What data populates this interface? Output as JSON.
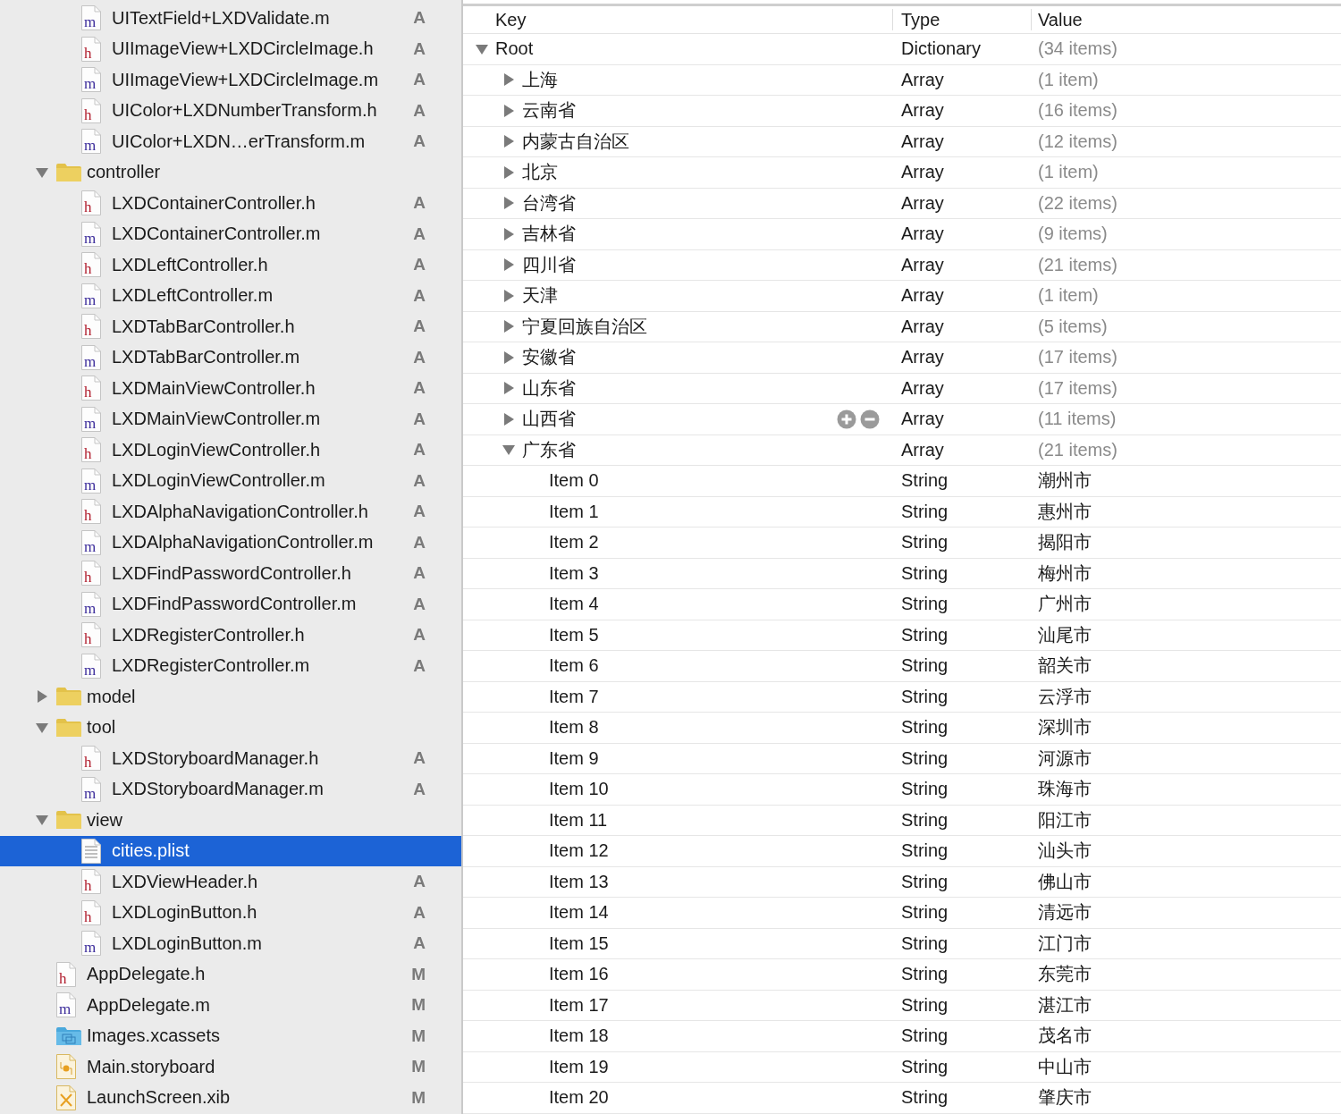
{
  "navigator": {
    "leading_items": [
      {
        "label": "UITextField+LXDValidate.m",
        "kind": "source",
        "icon_letter": "m",
        "status": "A",
        "selected": false
      },
      {
        "label": "UIImageView+LXDCircleImage.h",
        "kind": "header",
        "icon_letter": "h",
        "status": "A",
        "selected": false
      },
      {
        "label": "UIImageView+LXDCircleImage.m",
        "kind": "source",
        "icon_letter": "m",
        "status": "A",
        "selected": false
      },
      {
        "label": "UIColor+LXDNumberTransform.h",
        "kind": "header",
        "icon_letter": "h",
        "status": "A",
        "selected": false
      },
      {
        "label": "UIColor+LXDN…erTransform.m",
        "kind": "source",
        "icon_letter": "m",
        "status": "A",
        "selected": false
      }
    ],
    "items": [
      {
        "label": "controller",
        "kind": "folder",
        "expanded": true,
        "selected": false,
        "children": [
          {
            "label": "LXDContainerController.h",
            "kind": "header",
            "icon_letter": "h",
            "status": "A",
            "selected": false
          },
          {
            "label": "LXDContainerController.m",
            "kind": "source",
            "icon_letter": "m",
            "status": "A",
            "selected": false
          },
          {
            "label": "LXDLeftController.h",
            "kind": "header",
            "icon_letter": "h",
            "status": "A",
            "selected": false
          },
          {
            "label": "LXDLeftController.m",
            "kind": "source",
            "icon_letter": "m",
            "status": "A",
            "selected": false
          },
          {
            "label": "LXDTabBarController.h",
            "kind": "header",
            "icon_letter": "h",
            "status": "A",
            "selected": false
          },
          {
            "label": "LXDTabBarController.m",
            "kind": "source",
            "icon_letter": "m",
            "status": "A",
            "selected": false
          },
          {
            "label": "LXDMainViewController.h",
            "kind": "header",
            "icon_letter": "h",
            "status": "A",
            "selected": false
          },
          {
            "label": "LXDMainViewController.m",
            "kind": "source",
            "icon_letter": "m",
            "status": "A",
            "selected": false
          },
          {
            "label": "LXDLoginViewController.h",
            "kind": "header",
            "icon_letter": "h",
            "status": "A",
            "selected": false
          },
          {
            "label": "LXDLoginViewController.m",
            "kind": "source",
            "icon_letter": "m",
            "status": "A",
            "selected": false
          },
          {
            "label": "LXDAlphaNavigationController.h",
            "kind": "header",
            "icon_letter": "h",
            "status": "A",
            "selected": false
          },
          {
            "label": "LXDAlphaNavigationController.m",
            "kind": "source",
            "icon_letter": "m",
            "status": "A",
            "selected": false
          },
          {
            "label": "LXDFindPasswordController.h",
            "kind": "header",
            "icon_letter": "h",
            "status": "A",
            "selected": false
          },
          {
            "label": "LXDFindPasswordController.m",
            "kind": "source",
            "icon_letter": "m",
            "status": "A",
            "selected": false
          },
          {
            "label": "LXDRegisterController.h",
            "kind": "header",
            "icon_letter": "h",
            "status": "A",
            "selected": false
          },
          {
            "label": "LXDRegisterController.m",
            "kind": "source",
            "icon_letter": "m",
            "status": "A",
            "selected": false
          }
        ]
      },
      {
        "label": "model",
        "kind": "folder",
        "expanded": false,
        "selected": false
      },
      {
        "label": "tool",
        "kind": "folder",
        "expanded": true,
        "selected": false,
        "children": [
          {
            "label": "LXDStoryboardManager.h",
            "kind": "header",
            "icon_letter": "h",
            "status": "A",
            "selected": false
          },
          {
            "label": "LXDStoryboardManager.m",
            "kind": "source",
            "icon_letter": "m",
            "status": "A",
            "selected": false
          }
        ]
      },
      {
        "label": "view",
        "kind": "folder",
        "expanded": true,
        "selected": false,
        "children": [
          {
            "label": "cities.plist",
            "kind": "plist",
            "selected": true
          },
          {
            "label": "LXDViewHeader.h",
            "kind": "header",
            "icon_letter": "h",
            "status": "A",
            "selected": false
          },
          {
            "label": "LXDLoginButton.h",
            "kind": "header",
            "icon_letter": "h",
            "status": "A",
            "selected": false
          },
          {
            "label": "LXDLoginButton.m",
            "kind": "source",
            "icon_letter": "m",
            "status": "A",
            "selected": false
          }
        ]
      },
      {
        "label": "AppDelegate.h",
        "kind": "header",
        "icon_letter": "h",
        "status": "M",
        "selected": false
      },
      {
        "label": "AppDelegate.m",
        "kind": "source",
        "icon_letter": "m",
        "status": "M",
        "selected": false
      },
      {
        "label": "Images.xcassets",
        "kind": "assets",
        "status": "M",
        "selected": false
      },
      {
        "label": "Main.storyboard",
        "kind": "storyboard",
        "status": "M",
        "selected": false
      },
      {
        "label": "LaunchScreen.xib",
        "kind": "xib",
        "status": "M",
        "selected": false
      }
    ]
  },
  "plist": {
    "columns": [
      "Key",
      "Type",
      "Value"
    ],
    "root": {
      "key": "Root",
      "type": "Dictionary",
      "value": "(34 items)",
      "kind": "container",
      "expanded": true,
      "hovered": false,
      "children": [
        {
          "key": "上海",
          "type": "Array",
          "value": "(1 item)",
          "kind": "container",
          "expanded": false,
          "hovered": false
        },
        {
          "key": "云南省",
          "type": "Array",
          "value": "(16 items)",
          "kind": "container",
          "expanded": false,
          "hovered": false
        },
        {
          "key": "内蒙古自治区",
          "type": "Array",
          "value": "(12 items)",
          "kind": "container",
          "expanded": false,
          "hovered": false
        },
        {
          "key": "北京",
          "type": "Array",
          "value": "(1 item)",
          "kind": "container",
          "expanded": false,
          "hovered": false
        },
        {
          "key": "台湾省",
          "type": "Array",
          "value": "(22 items)",
          "kind": "container",
          "expanded": false,
          "hovered": false
        },
        {
          "key": "吉林省",
          "type": "Array",
          "value": "(9 items)",
          "kind": "container",
          "expanded": false,
          "hovered": false
        },
        {
          "key": "四川省",
          "type": "Array",
          "value": "(21 items)",
          "kind": "container",
          "expanded": false,
          "hovered": false
        },
        {
          "key": "天津",
          "type": "Array",
          "value": "(1 item)",
          "kind": "container",
          "expanded": false,
          "hovered": false
        },
        {
          "key": "宁夏回族自治区",
          "type": "Array",
          "value": "(5 items)",
          "kind": "container",
          "expanded": false,
          "hovered": false
        },
        {
          "key": "安徽省",
          "type": "Array",
          "value": "(17 items)",
          "kind": "container",
          "expanded": false,
          "hovered": false
        },
        {
          "key": "山东省",
          "type": "Array",
          "value": "(17 items)",
          "kind": "container",
          "expanded": false,
          "hovered": false
        },
        {
          "key": "山西省",
          "type": "Array",
          "value": "(11 items)",
          "kind": "container",
          "expanded": false,
          "hovered": true
        },
        {
          "key": "广东省",
          "type": "Array",
          "value": "(21 items)",
          "kind": "container",
          "expanded": true,
          "hovered": false,
          "children": [
            {
              "key": "Item 0",
              "type": "String",
              "value": "潮州市",
              "kind": "string",
              "hovered": false
            },
            {
              "key": "Item 1",
              "type": "String",
              "value": "惠州市",
              "kind": "string",
              "hovered": false
            },
            {
              "key": "Item 2",
              "type": "String",
              "value": "揭阳市",
              "kind": "string",
              "hovered": false
            },
            {
              "key": "Item 3",
              "type": "String",
              "value": "梅州市",
              "kind": "string",
              "hovered": false
            },
            {
              "key": "Item 4",
              "type": "String",
              "value": "广州市",
              "kind": "string",
              "hovered": false
            },
            {
              "key": "Item 5",
              "type": "String",
              "value": "汕尾市",
              "kind": "string",
              "hovered": false
            },
            {
              "key": "Item 6",
              "type": "String",
              "value": "韶关市",
              "kind": "string",
              "hovered": false
            },
            {
              "key": "Item 7",
              "type": "String",
              "value": "云浮市",
              "kind": "string",
              "hovered": false
            },
            {
              "key": "Item 8",
              "type": "String",
              "value": "深圳市",
              "kind": "string",
              "hovered": false
            },
            {
              "key": "Item 9",
              "type": "String",
              "value": "河源市",
              "kind": "string",
              "hovered": false
            },
            {
              "key": "Item 10",
              "type": "String",
              "value": "珠海市",
              "kind": "string",
              "hovered": false
            },
            {
              "key": "Item 11",
              "type": "String",
              "value": "阳江市",
              "kind": "string",
              "hovered": false
            },
            {
              "key": "Item 12",
              "type": "String",
              "value": "汕头市",
              "kind": "string",
              "hovered": false
            },
            {
              "key": "Item 13",
              "type": "String",
              "value": "佛山市",
              "kind": "string",
              "hovered": false
            },
            {
              "key": "Item 14",
              "type": "String",
              "value": "清远市",
              "kind": "string",
              "hovered": false
            },
            {
              "key": "Item 15",
              "type": "String",
              "value": "江门市",
              "kind": "string",
              "hovered": false
            },
            {
              "key": "Item 16",
              "type": "String",
              "value": "东莞市",
              "kind": "string",
              "hovered": false
            },
            {
              "key": "Item 17",
              "type": "String",
              "value": "湛江市",
              "kind": "string",
              "hovered": false
            },
            {
              "key": "Item 18",
              "type": "String",
              "value": "茂名市",
              "kind": "string",
              "hovered": false
            },
            {
              "key": "Item 19",
              "type": "String",
              "value": "中山市",
              "kind": "string",
              "hovered": false
            },
            {
              "key": "Item 20",
              "type": "String",
              "value": "肇庆市",
              "kind": "string",
              "hovered": false
            }
          ]
        }
      ]
    }
  }
}
